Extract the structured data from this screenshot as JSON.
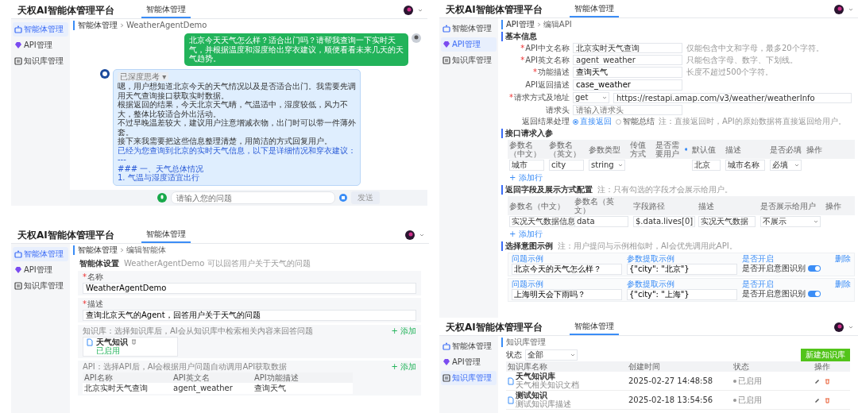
{
  "screens": [
    {
      "kind": "chat",
      "header": {
        "title": "天权AI智能体管理平台",
        "tab": {
          "label": "智能体管理",
          "selected": true
        }
      },
      "sidebar": [
        {
          "label": "智能体管理",
          "selected": true
        },
        {
          "label": "API管理",
          "selected": false
        },
        {
          "label": "知识库管理",
          "selected": false
        }
      ],
      "breadcrumb": [
        "智能体管理",
        "WeatherAgentDemo"
      ],
      "messages": [
        {
          "kind": "user",
          "text": "北京今天天气怎么样？适合出门吗？请帮我查询一下实时天气，并根据温度和湿度给出穿衣建议，顺便看看未来几天的天气趋势。"
        },
        {
          "kind": "bot",
          "tag": "已深度思考 ▾",
          "paragraphs": [
            "嗯，用户想知道北京今天的天气情况以及是否适合出门。我需要先调用天气查询接口获取实时数据。",
            "根据返回的结果，今天北京天气晴，气温适中，湿度较低，风力不大，整体比较适合外出活动。",
            "不过早晚温差较大，建议用户注意增减衣物，出门时可以带一件薄外套。",
            "接下来我需要把这些信息整理清楚，用简洁的方式回复用户。"
          ],
          "links": [
            "已经为您查询到北京的实时天气信息，以下是详细情况和穿衣建议："
          ],
          "lines": [
            "---",
            "### 一、天气总体情况",
            "1. 气温与湿度适宜出行"
          ]
        }
      ],
      "input": {
        "placeholder": "请输入您的问题",
        "button": "发送"
      }
    },
    {
      "kind": "api_form",
      "header": {
        "title": "天权AI智能体管理平台",
        "tab": {
          "label": "智能体管理",
          "selected": true
        }
      },
      "sidebar": [
        {
          "label": "智能体管理",
          "selected": false
        },
        {
          "label": "API管理",
          "selected": true
        },
        {
          "label": "知识库管理",
          "selected": false
        }
      ],
      "breadcrumb": [
        "API管理",
        "编辑API"
      ],
      "section": "基本信息",
      "fields": [
        {
          "label": "API中文名称",
          "mark": "*",
          "kind": "input",
          "value": "北京实时天气查询",
          "hint": "仅能包含中文和字母，最多20个字符。"
        },
        {
          "label": "API英文名称",
          "mark": "*",
          "kind": "input",
          "value": "agent_weather",
          "hint": "只能包含字母、数字、下划线。"
        },
        {
          "label": "功能描述",
          "mark": "*",
          "kind": "textarea",
          "value": "查询天气",
          "hint": "长度不超过500个字符。"
        },
        {
          "label": "API返回描述",
          "kind": "textarea",
          "value": "case_weather"
        },
        {
          "label": "请求方式及地址",
          "mark": "*",
          "kind": "url",
          "method": "get",
          "value": "https://restapi.amap.com/v3/weather/weatherInfo"
        },
        {
          "label": "请求头",
          "kind": "input",
          "placeholder": "请输入请求头"
        },
        {
          "label": "返回结果处理",
          "kind": "radio",
          "options": [
            {
              "label": "直接返回",
              "selected": true
            },
            {
              "label": "智能总结",
              "selected": false
            }
          ],
          "hint": "注：直接返回时，API的原始数据将直接返回给用户。"
        }
      ],
      "params": {
        "title": "接口请求入参",
        "columns": [
          "参数名（中文）",
          "参数名（英文）",
          "参数类型",
          "传值方式",
          "是否需要用户",
          "默认值",
          "描述",
          "是否必填",
          "操作"
        ],
        "row": {
          "name_cn": "城市",
          "name_en": "city",
          "type": "string",
          "default": "北京",
          "desc": "城市名称",
          "required": "必填"
        },
        "add": "+ 添加行"
      },
      "returns": {
        "title": "返回字段及展示方式配置",
        "note": "注：只有勾选的字段才会展示给用户。",
        "columns": [
          "参数名（中文）",
          "参数名（英文）",
          "字段路径",
          "描述",
          "是否展示给用户",
          "操作"
        ],
        "row": {
          "name_cn": "实况天气数据信息",
          "name_en": "data",
          "path": "$.data.lives[0]",
          "desc": "实况天气数据",
          "show": "不展示"
        },
        "add": "+ 添加行"
      },
      "examples": {
        "title": "选择意图示例",
        "note": "注：用户提问与示例相似时，AI会优先调用此API。",
        "items": [
          {
            "q_label": "问题示例",
            "question": "北京今天的天气怎么样？",
            "p_label": "参数提取示例",
            "params": "{\"city\": \"北京\"}",
            "s_label": "是否开启",
            "toggle_label": "是否开启意图识别",
            "on": true,
            "delete": "删除"
          },
          {
            "q_label": "问题示例",
            "question": "上海明天会下雨吗？",
            "p_label": "参数提取示例",
            "params": "{\"city\": \"上海\"}",
            "s_label": "是否开启",
            "toggle_label": "是否开启意图识别",
            "on": true,
            "delete": "删除"
          }
        ]
      }
    },
    {
      "kind": "agent_form",
      "header": {
        "title": "天权AI智能体管理平台",
        "tab": {
          "label": "智能体管理",
          "selected": true
        }
      },
      "sidebar": [
        {
          "label": "智能体管理",
          "selected": true
        },
        {
          "label": "API管理",
          "selected": false
        },
        {
          "label": "知识库管理",
          "selected": false
        }
      ],
      "breadcrumb": [
        "智能体管理",
        "编辑智能体"
      ],
      "heading": "智能体设置",
      "subheading": "WeatherAgentDemo 可以回答用户关于天气的问题",
      "name": {
        "mark": "*",
        "label": "名称",
        "value": "WeatherAgentDemo"
      },
      "description": {
        "mark": "*",
        "label": "描述",
        "value": "查询北京天气的Agent，回答用户关于天气的问题"
      },
      "knowledge": {
        "text": "知识库：选择知识库后，AI会从知识库中检索相关内容来回答问题",
        "add": "+ 添加",
        "doc": {
          "name": "天气知识",
          "status": "已启用"
        }
      },
      "apis": {
        "text": "API：选择API后，AI会根据用户问题自动调用API获取数据",
        "add": "+ 添加",
        "columns": [
          "API名称",
          "API英文名",
          "API功能描述"
        ],
        "row": [
          "北京实时天气查询",
          "agent_weather",
          "查询天气"
        ]
      }
    },
    {
      "kind": "kb_list",
      "header": {
        "title": "天权AI智能体管理平台",
        "tab": {
          "label": "智能体管理",
          "selected": true
        }
      },
      "sidebar": [
        {
          "label": "智能体管理",
          "selected": false
        },
        {
          "label": "API管理",
          "selected": false
        },
        {
          "label": "知识库管理",
          "selected": true
        }
      ],
      "breadcrumb": [
        "知识库管理"
      ],
      "filter": {
        "label": "状态",
        "value": "全部"
      },
      "new_button": "新建知识库",
      "columns": [
        "知识库名称",
        "创建时间",
        "状态",
        "操作"
      ],
      "rows": [
        {
          "name": "天气知识库",
          "desc": "天气相关知识文档",
          "time": "2025-02-27 14:48:58",
          "status": "已启用"
        },
        {
          "name": "测试知识",
          "desc": "测试知识库描述",
          "time": "2025-02-18 13:54:56",
          "status": "已启用"
        }
      ]
    }
  ]
}
